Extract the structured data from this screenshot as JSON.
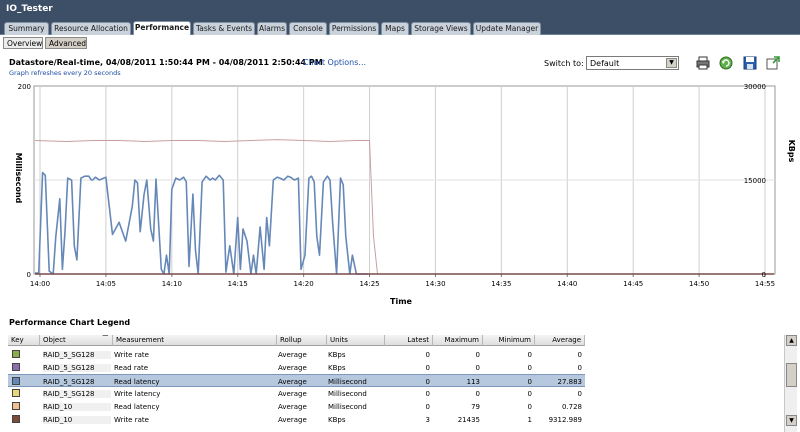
{
  "window": {
    "title": "IO_Tester"
  },
  "tabs": [
    {
      "label": "Summary",
      "active": false
    },
    {
      "label": "Resource Allocation",
      "active": false
    },
    {
      "label": "Performance",
      "active": true
    },
    {
      "label": "Tasks & Events",
      "active": false
    },
    {
      "label": "Alarms",
      "active": false
    },
    {
      "label": "Console",
      "active": false
    },
    {
      "label": "Permissions",
      "active": false
    },
    {
      "label": "Maps",
      "active": false
    },
    {
      "label": "Storage Views",
      "active": false
    },
    {
      "label": "Update Manager",
      "active": false
    }
  ],
  "subtabs": [
    {
      "label": "Overview",
      "active": false
    },
    {
      "label": "Advanced",
      "active": true
    }
  ],
  "header": {
    "title": "Datastore/Real-time, 04/08/2011 1:50:44 PM - 04/08/2011 2:50:44 PM",
    "chart_options": "Chart Options...",
    "refresh_note": "Graph refreshes every 20 seconds"
  },
  "switch_to": {
    "label": "Switch to:",
    "value": "Default"
  },
  "toolbar": {
    "icons": [
      "print-icon",
      "refresh-icon",
      "save-icon",
      "popout-icon"
    ]
  },
  "colors": {
    "read_latency": "#6688b8",
    "write_latency": "#c8a0a0",
    "write_rate_raid10": "#7a4a4a",
    "grid": "#cfcfcf"
  },
  "chart_data": {
    "type": "line",
    "title": "",
    "xlabel": "Time",
    "ylabel_left": "Millisecond",
    "ylabel_right": "KBps",
    "ylim_left": [
      0,
      200
    ],
    "ylim_right": [
      0,
      30000
    ],
    "yticks_left": [
      "200",
      "0"
    ],
    "yticks_right": [
      "30000",
      "15000",
      "0"
    ],
    "xticks": [
      "14:00",
      "14:05",
      "14:10",
      "14:15",
      "14:20",
      "14:25",
      "14:30",
      "14:35",
      "14:40",
      "14:45",
      "14:50",
      "14:55"
    ],
    "x_range_minutes": [
      0,
      60
    ],
    "grid": true,
    "series": [
      {
        "name": "RAID_5_SG128 Read latency",
        "axis": "left",
        "color": "#6688b8",
        "x": [
          -0.5,
          -0.1,
          0.2,
          0.4,
          0.7,
          1.0,
          1.2,
          1.5,
          1.7,
          1.9,
          2.1,
          2.4,
          2.6,
          2.8,
          3.1,
          3.4,
          3.7,
          3.9,
          4.0,
          4.2,
          4.5,
          5.0,
          5.5,
          6.0,
          6.5,
          7.0,
          7.2,
          7.4,
          7.6,
          7.9,
          8.1,
          8.4,
          8.6,
          8.8,
          9.2,
          9.4,
          9.6,
          9.8,
          10.0,
          10.3,
          10.6,
          10.9,
          11.1,
          11.3,
          11.6,
          11.8,
          12.0,
          12.3,
          12.6,
          12.9,
          13.1,
          13.3,
          13.6,
          13.9,
          14.1,
          14.4,
          14.7,
          15.0,
          15.2,
          15.4,
          15.7,
          16.0,
          16.2,
          16.4,
          16.7,
          17.0,
          17.2,
          17.4,
          17.7,
          18.0,
          18.2,
          18.5,
          18.8,
          19.0,
          19.3,
          19.6,
          19.8,
          20.1,
          20.4,
          20.6,
          20.8,
          21.0,
          21.2,
          21.5,
          21.8,
          22.0,
          22.2,
          22.5,
          22.8,
          23.0,
          23.2,
          23.5,
          23.7,
          24.0,
          24.2,
          24.5,
          24.7,
          24.9
        ],
        "values": [
          1,
          1,
          108,
          105,
          3,
          0,
          40,
          80,
          5,
          45,
          102,
          100,
          30,
          15,
          102,
          104,
          104,
          100,
          100,
          103,
          100,
          103,
          42,
          55,
          35,
          72,
          100,
          97,
          45,
          85,
          100,
          48,
          35,
          101,
          5,
          0,
          20,
          0,
          90,
          102,
          100,
          103,
          98,
          8,
          85,
          25,
          0,
          98,
          104,
          100,
          102,
          100,
          105,
          100,
          2,
          30,
          0,
          60,
          5,
          48,
          35,
          0,
          20,
          0,
          50,
          5,
          60,
          30,
          100,
          103,
          102,
          100,
          104,
          103,
          100,
          102,
          5,
          20,
          102,
          104,
          98,
          40,
          20,
          98,
          104,
          100,
          55,
          0,
          102,
          95,
          40,
          0,
          20,
          0,
          0,
          0,
          0,
          0
        ]
      },
      {
        "name": "RAID_5_SG128 Write latency",
        "axis": "left",
        "color": "#c8a0a0",
        "x": [
          -0.5,
          2,
          4,
          6,
          8,
          10,
          12,
          14,
          16,
          18,
          20,
          22,
          24,
          25.0,
          25.3,
          25.6
        ],
        "values": [
          142,
          141,
          142,
          142,
          141,
          142,
          142,
          141,
          142,
          143,
          142,
          141,
          142,
          142,
          40,
          0
        ]
      },
      {
        "name": "RAID_10 Write rate",
        "axis": "right",
        "color": "#7a4a4a",
        "x": [
          -0.5,
          25.5,
          40,
          60
        ],
        "values": [
          0,
          0,
          0,
          0
        ]
      }
    ]
  },
  "legend": {
    "title": "Performance Chart Legend",
    "columns": [
      "Key",
      "Object",
      "Measurement",
      "Rollup",
      "Units",
      "Latest",
      "Maximum",
      "Minimum",
      "Average"
    ],
    "rows": [
      {
        "color": "#8bae4a",
        "object": "RAID_5_SG128",
        "measurement": "Write rate",
        "rollup": "Average",
        "units": "KBps",
        "latest": "0",
        "maximum": "0",
        "minimum": "0",
        "average": "0",
        "selected": false
      },
      {
        "color": "#8a70b0",
        "object": "RAID_5_SG128",
        "measurement": "Read rate",
        "rollup": "Average",
        "units": "KBps",
        "latest": "0",
        "maximum": "0",
        "minimum": "0",
        "average": "0",
        "selected": false
      },
      {
        "color": "#6688b8",
        "object": "RAID_5_SG128",
        "measurement": "Read latency",
        "rollup": "Average",
        "units": "Millisecond",
        "latest": "0",
        "maximum": "113",
        "minimum": "0",
        "average": "27.883",
        "selected": true
      },
      {
        "color": "#e8d878",
        "object": "RAID_5_SG128",
        "measurement": "Write latency",
        "rollup": "Average",
        "units": "Millisecond",
        "latest": "0",
        "maximum": "0",
        "minimum": "0",
        "average": "0",
        "selected": false
      },
      {
        "color": "#f0c090",
        "object": "RAID_10",
        "measurement": "Read latency",
        "rollup": "Average",
        "units": "Millisecond",
        "latest": "0",
        "maximum": "79",
        "minimum": "0",
        "average": "0.728",
        "selected": false
      },
      {
        "color": "#7a4a3a",
        "object": "RAID_10",
        "measurement": "Write rate",
        "rollup": "Average",
        "units": "KBps",
        "latest": "3",
        "maximum": "21435",
        "minimum": "1",
        "average": "9312.989",
        "selected": false
      }
    ]
  }
}
